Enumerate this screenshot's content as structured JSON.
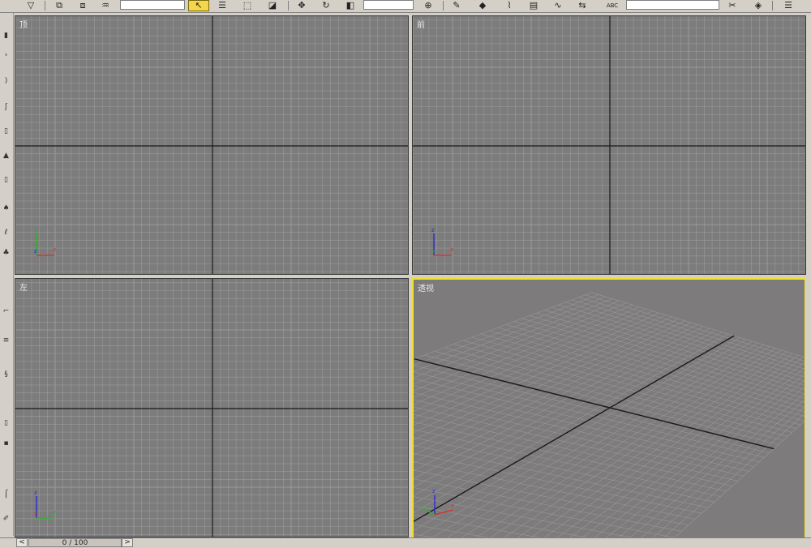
{
  "toolbar": {
    "icons": [
      "select-filter-icon",
      "link-icon",
      "unlink-icon",
      "bind-spacewarp-icon",
      "select-object-icon",
      "select-by-name-icon",
      "select-region-icon",
      "window-crossing-icon",
      "move-icon",
      "rotate-icon",
      "scale-icon",
      "mirror-icon",
      "align-icon",
      "layer-icon",
      "curve-editor-icon",
      "schematic-view-icon",
      "material-editor-icon",
      "render-setup-icon",
      "render-icon",
      "named-selection-icon"
    ]
  },
  "viewports": {
    "top": {
      "label": "顶",
      "axes": [
        "y",
        "z",
        "x"
      ]
    },
    "front": {
      "label": "前",
      "axes": [
        "z",
        "y",
        "x"
      ]
    },
    "left": {
      "label": "左",
      "axes": [
        "z",
        "x",
        "y"
      ]
    },
    "perspective": {
      "label": "透视",
      "axes": [
        "z",
        "y",
        "x"
      ],
      "active": true
    }
  },
  "colors": {
    "viewport_bg": "#7c7c7c",
    "grid_line": "#9a9a9a",
    "grid_axis": "#1a1a1a",
    "active_border": "#f0e02a",
    "axis_x": "#d83030",
    "axis_y": "#30b030",
    "axis_z": "#3030d0"
  },
  "timeline": {
    "frame_label": "0 / 100",
    "prev_label": "<",
    "next_label": ">"
  }
}
